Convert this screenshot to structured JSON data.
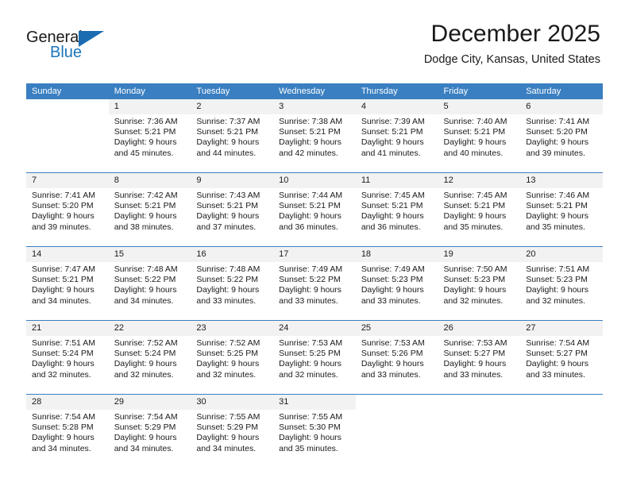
{
  "brand": {
    "name_top": "General",
    "name_bottom": "Blue",
    "accent_color": "#1b75bb",
    "triangle_color": "#1b6cb0"
  },
  "header": {
    "title": "December 2025",
    "subtitle": "Dodge City, Kansas, United States"
  },
  "calendar": {
    "header_bg": "#3a7fc1",
    "weekday_headers": [
      "Sunday",
      "Monday",
      "Tuesday",
      "Wednesday",
      "Thursday",
      "Friday",
      "Saturday"
    ],
    "weeks": [
      [
        {
          "day": "",
          "sunrise": "",
          "sunset": "",
          "daylight_a": "",
          "daylight_b": ""
        },
        {
          "day": "1",
          "sunrise": "Sunrise: 7:36 AM",
          "sunset": "Sunset: 5:21 PM",
          "daylight_a": "Daylight: 9 hours",
          "daylight_b": "and 45 minutes."
        },
        {
          "day": "2",
          "sunrise": "Sunrise: 7:37 AM",
          "sunset": "Sunset: 5:21 PM",
          "daylight_a": "Daylight: 9 hours",
          "daylight_b": "and 44 minutes."
        },
        {
          "day": "3",
          "sunrise": "Sunrise: 7:38 AM",
          "sunset": "Sunset: 5:21 PM",
          "daylight_a": "Daylight: 9 hours",
          "daylight_b": "and 42 minutes."
        },
        {
          "day": "4",
          "sunrise": "Sunrise: 7:39 AM",
          "sunset": "Sunset: 5:21 PM",
          "daylight_a": "Daylight: 9 hours",
          "daylight_b": "and 41 minutes."
        },
        {
          "day": "5",
          "sunrise": "Sunrise: 7:40 AM",
          "sunset": "Sunset: 5:21 PM",
          "daylight_a": "Daylight: 9 hours",
          "daylight_b": "and 40 minutes."
        },
        {
          "day": "6",
          "sunrise": "Sunrise: 7:41 AM",
          "sunset": "Sunset: 5:20 PM",
          "daylight_a": "Daylight: 9 hours",
          "daylight_b": "and 39 minutes."
        }
      ],
      [
        {
          "day": "7",
          "sunrise": "Sunrise: 7:41 AM",
          "sunset": "Sunset: 5:20 PM",
          "daylight_a": "Daylight: 9 hours",
          "daylight_b": "and 39 minutes."
        },
        {
          "day": "8",
          "sunrise": "Sunrise: 7:42 AM",
          "sunset": "Sunset: 5:21 PM",
          "daylight_a": "Daylight: 9 hours",
          "daylight_b": "and 38 minutes."
        },
        {
          "day": "9",
          "sunrise": "Sunrise: 7:43 AM",
          "sunset": "Sunset: 5:21 PM",
          "daylight_a": "Daylight: 9 hours",
          "daylight_b": "and 37 minutes."
        },
        {
          "day": "10",
          "sunrise": "Sunrise: 7:44 AM",
          "sunset": "Sunset: 5:21 PM",
          "daylight_a": "Daylight: 9 hours",
          "daylight_b": "and 36 minutes."
        },
        {
          "day": "11",
          "sunrise": "Sunrise: 7:45 AM",
          "sunset": "Sunset: 5:21 PM",
          "daylight_a": "Daylight: 9 hours",
          "daylight_b": "and 36 minutes."
        },
        {
          "day": "12",
          "sunrise": "Sunrise: 7:45 AM",
          "sunset": "Sunset: 5:21 PM",
          "daylight_a": "Daylight: 9 hours",
          "daylight_b": "and 35 minutes."
        },
        {
          "day": "13",
          "sunrise": "Sunrise: 7:46 AM",
          "sunset": "Sunset: 5:21 PM",
          "daylight_a": "Daylight: 9 hours",
          "daylight_b": "and 35 minutes."
        }
      ],
      [
        {
          "day": "14",
          "sunrise": "Sunrise: 7:47 AM",
          "sunset": "Sunset: 5:21 PM",
          "daylight_a": "Daylight: 9 hours",
          "daylight_b": "and 34 minutes."
        },
        {
          "day": "15",
          "sunrise": "Sunrise: 7:48 AM",
          "sunset": "Sunset: 5:22 PM",
          "daylight_a": "Daylight: 9 hours",
          "daylight_b": "and 34 minutes."
        },
        {
          "day": "16",
          "sunrise": "Sunrise: 7:48 AM",
          "sunset": "Sunset: 5:22 PM",
          "daylight_a": "Daylight: 9 hours",
          "daylight_b": "and 33 minutes."
        },
        {
          "day": "17",
          "sunrise": "Sunrise: 7:49 AM",
          "sunset": "Sunset: 5:22 PM",
          "daylight_a": "Daylight: 9 hours",
          "daylight_b": "and 33 minutes."
        },
        {
          "day": "18",
          "sunrise": "Sunrise: 7:49 AM",
          "sunset": "Sunset: 5:23 PM",
          "daylight_a": "Daylight: 9 hours",
          "daylight_b": "and 33 minutes."
        },
        {
          "day": "19",
          "sunrise": "Sunrise: 7:50 AM",
          "sunset": "Sunset: 5:23 PM",
          "daylight_a": "Daylight: 9 hours",
          "daylight_b": "and 32 minutes."
        },
        {
          "day": "20",
          "sunrise": "Sunrise: 7:51 AM",
          "sunset": "Sunset: 5:23 PM",
          "daylight_a": "Daylight: 9 hours",
          "daylight_b": "and 32 minutes."
        }
      ],
      [
        {
          "day": "21",
          "sunrise": "Sunrise: 7:51 AM",
          "sunset": "Sunset: 5:24 PM",
          "daylight_a": "Daylight: 9 hours",
          "daylight_b": "and 32 minutes."
        },
        {
          "day": "22",
          "sunrise": "Sunrise: 7:52 AM",
          "sunset": "Sunset: 5:24 PM",
          "daylight_a": "Daylight: 9 hours",
          "daylight_b": "and 32 minutes."
        },
        {
          "day": "23",
          "sunrise": "Sunrise: 7:52 AM",
          "sunset": "Sunset: 5:25 PM",
          "daylight_a": "Daylight: 9 hours",
          "daylight_b": "and 32 minutes."
        },
        {
          "day": "24",
          "sunrise": "Sunrise: 7:53 AM",
          "sunset": "Sunset: 5:25 PM",
          "daylight_a": "Daylight: 9 hours",
          "daylight_b": "and 32 minutes."
        },
        {
          "day": "25",
          "sunrise": "Sunrise: 7:53 AM",
          "sunset": "Sunset: 5:26 PM",
          "daylight_a": "Daylight: 9 hours",
          "daylight_b": "and 33 minutes."
        },
        {
          "day": "26",
          "sunrise": "Sunrise: 7:53 AM",
          "sunset": "Sunset: 5:27 PM",
          "daylight_a": "Daylight: 9 hours",
          "daylight_b": "and 33 minutes."
        },
        {
          "day": "27",
          "sunrise": "Sunrise: 7:54 AM",
          "sunset": "Sunset: 5:27 PM",
          "daylight_a": "Daylight: 9 hours",
          "daylight_b": "and 33 minutes."
        }
      ],
      [
        {
          "day": "28",
          "sunrise": "Sunrise: 7:54 AM",
          "sunset": "Sunset: 5:28 PM",
          "daylight_a": "Daylight: 9 hours",
          "daylight_b": "and 34 minutes."
        },
        {
          "day": "29",
          "sunrise": "Sunrise: 7:54 AM",
          "sunset": "Sunset: 5:29 PM",
          "daylight_a": "Daylight: 9 hours",
          "daylight_b": "and 34 minutes."
        },
        {
          "day": "30",
          "sunrise": "Sunrise: 7:55 AM",
          "sunset": "Sunset: 5:29 PM",
          "daylight_a": "Daylight: 9 hours",
          "daylight_b": "and 34 minutes."
        },
        {
          "day": "31",
          "sunrise": "Sunrise: 7:55 AM",
          "sunset": "Sunset: 5:30 PM",
          "daylight_a": "Daylight: 9 hours",
          "daylight_b": "and 35 minutes."
        },
        {
          "day": "",
          "sunrise": "",
          "sunset": "",
          "daylight_a": "",
          "daylight_b": ""
        },
        {
          "day": "",
          "sunrise": "",
          "sunset": "",
          "daylight_a": "",
          "daylight_b": ""
        },
        {
          "day": "",
          "sunrise": "",
          "sunset": "",
          "daylight_a": "",
          "daylight_b": ""
        }
      ]
    ]
  }
}
